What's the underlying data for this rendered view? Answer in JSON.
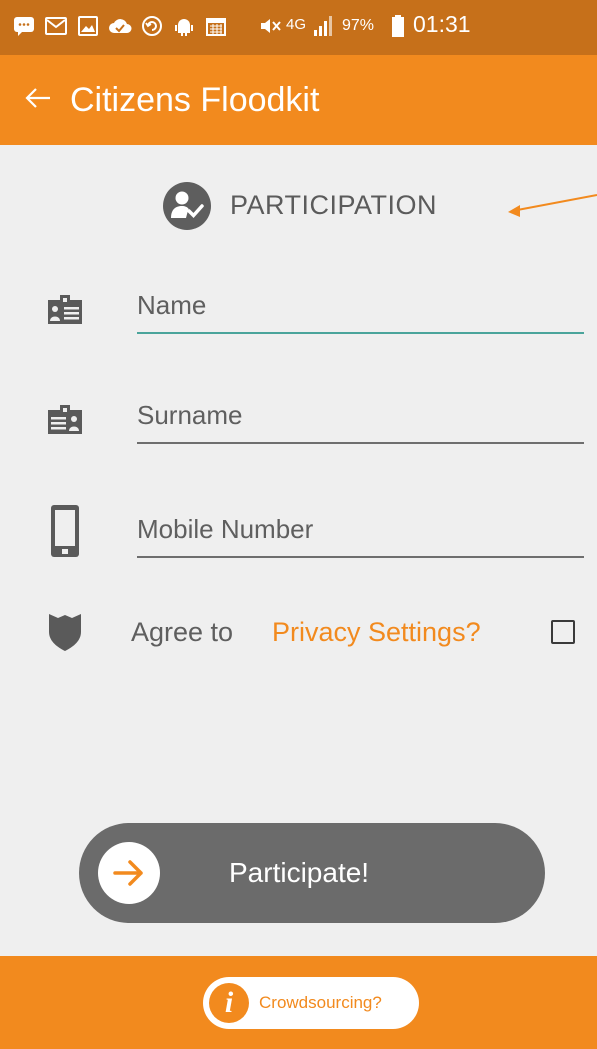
{
  "status_bar": {
    "battery_percent": "97%",
    "network_type": "4G",
    "time": "01:31",
    "icons": [
      "messages-icon",
      "gmail-icon",
      "gallery-icon",
      "cloud-check-icon",
      "sync-icon",
      "android-debug-icon",
      "calendar-icon",
      "mute-icon",
      "signal-icon",
      "battery-icon"
    ]
  },
  "app_bar": {
    "title": "Citizens Floodkit",
    "back_icon": "back-arrow-icon"
  },
  "section": {
    "title": "PARTICIPATION",
    "icon": "user-check-icon"
  },
  "form": {
    "name_placeholder": "Name",
    "surname_placeholder": "Surname",
    "mobile_placeholder": "Mobile Number",
    "agree_label": "Agree to",
    "privacy_link": "Privacy Settings?",
    "agree_checked": false
  },
  "participate_button": {
    "label": "Participate!",
    "icon": "arrow-right-icon"
  },
  "footer": {
    "crowdsourcing_label": "Crowdsourcing?",
    "info_icon": "i"
  },
  "colors": {
    "accent": "#f28a1e",
    "status_bar": "#c6701a",
    "background": "#efefef",
    "button": "#6b6b6b",
    "active_field_line": "#4aa49b"
  }
}
